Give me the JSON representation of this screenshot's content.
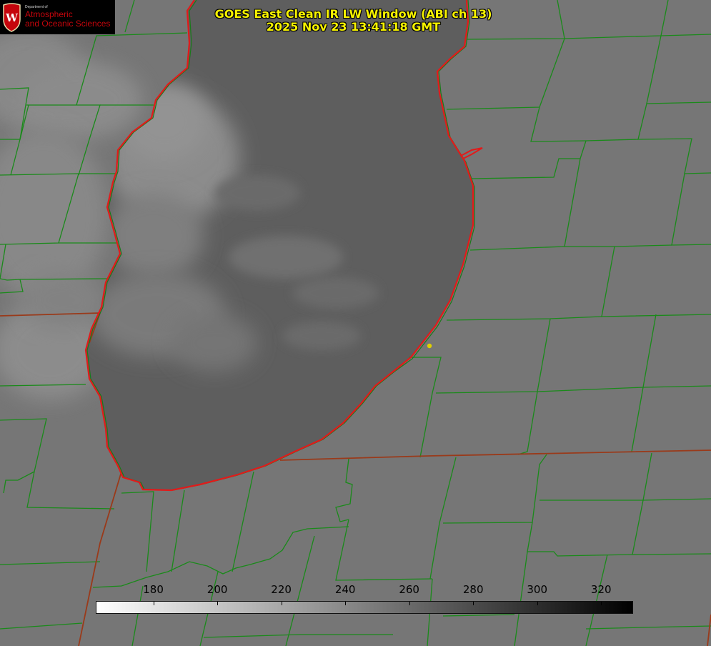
{
  "title": {
    "line1": "GOES East Clean IR LW Window (ABI ch 13)",
    "line2": "2025 Nov 23 13:41:18 GMT"
  },
  "logo": {
    "department": "Department of",
    "line1": "Atmospheric",
    "line2": "and Oceanic Sciences",
    "crest_letter": "W",
    "crest_color": "#c5050c"
  },
  "colorbar": {
    "min": 162,
    "max": 330,
    "ticks": [
      "180",
      "200",
      "220",
      "240",
      "260",
      "280",
      "300",
      "320"
    ],
    "tick_values": [
      180,
      200,
      220,
      240,
      260,
      280,
      300,
      320
    ],
    "low_color": "#ffffff",
    "high_color": "#000000"
  },
  "map": {
    "land_color": "#767676",
    "lake_color": "#5f5f5f",
    "county_line_color": "#1a8a1a",
    "state_line_color": "#9a3a1a",
    "coastline_color": "#e21a1a",
    "marker_color": "#e0d000"
  }
}
